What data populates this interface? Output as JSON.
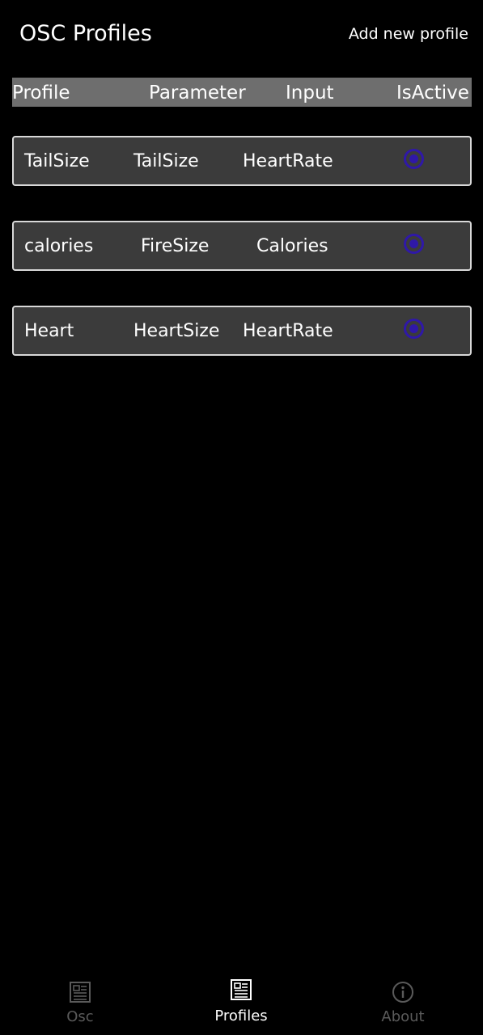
{
  "header": {
    "title": "OSC Profiles",
    "add_label": "Add new profile"
  },
  "columns": {
    "profile": "Profile",
    "parameter": "Parameter",
    "input": "Input",
    "is_active": "IsActive"
  },
  "profiles": [
    {
      "profile": "TailSize",
      "parameter": "TailSize",
      "input": "HeartRate",
      "active": true
    },
    {
      "profile": "calories",
      "parameter": "FireSize",
      "input": "Calories",
      "active": true
    },
    {
      "profile": "Heart",
      "parameter": "HeartSize",
      "input": "HeartRate",
      "active": true
    }
  ],
  "nav": {
    "items": [
      {
        "label": "Osc",
        "icon": "newspaper-icon",
        "active": false
      },
      {
        "label": "Profiles",
        "icon": "newspaper-icon",
        "active": true
      },
      {
        "label": "About",
        "icon": "info-icon",
        "active": false
      }
    ]
  },
  "colors": {
    "background": "#000000",
    "header_row": "#6e6e6e",
    "card": "#3b3b3b",
    "card_border": "#d8d8d8",
    "radio": "#2f18a8",
    "nav_active": "#ffffff",
    "nav_inactive": "#5a5a5a"
  }
}
